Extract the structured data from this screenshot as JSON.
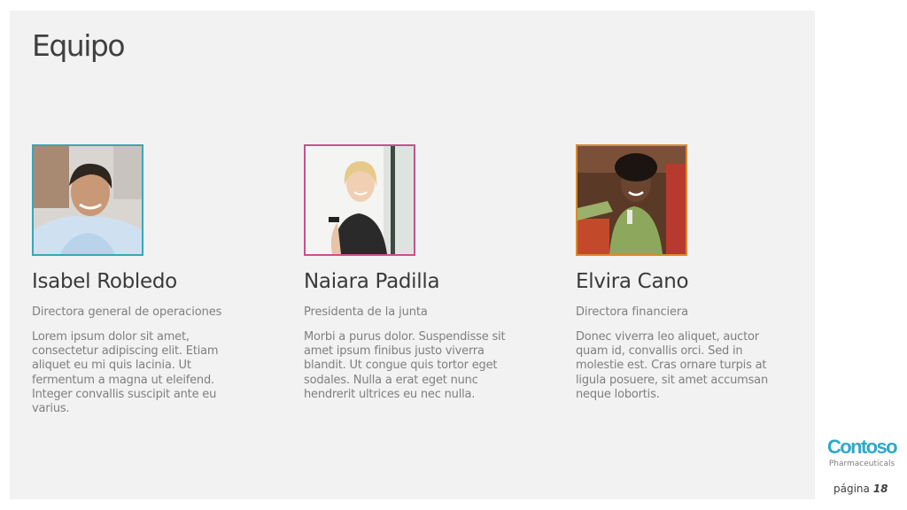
{
  "slide": {
    "title": "Equipo",
    "page_label": "página",
    "page_number": "18"
  },
  "members": [
    {
      "name": "Isabel Robledo",
      "role": "Directora general de operaciones",
      "bio": "Lorem ipsum dolor sit amet, consectetur adipiscing elit. Etiam aliquet eu mi quis lacinia. Ut fermentum a magna ut eleifend. Integer convallis suscipit ante eu varius.",
      "frame_color": "#3aa6b8"
    },
    {
      "name": "Naiara Padilla",
      "role": "Presidenta de la junta",
      "bio": "Morbi a purus dolor. Suspendisse sit amet ipsum finibus justo viverra blandit. Ut congue quis tortor eget sodales. Nulla a erat eget nunc hendrerit ultrices eu nec nulla.",
      "frame_color": "#c8518b"
    },
    {
      "name": "Elvira Cano",
      "role": "Directora financiera",
      "bio": "Donec viverra leo aliquet, auctor quam id, convallis orci. Sed in molestie est. Cras ornare turpis at ligula posuere, sit amet accumsan neque lobortis.",
      "frame_color": "#d98b2b"
    }
  ],
  "logo": {
    "name": "Contoso",
    "subtitle": "Pharmaceuticals",
    "color": "#2fa8c9"
  }
}
